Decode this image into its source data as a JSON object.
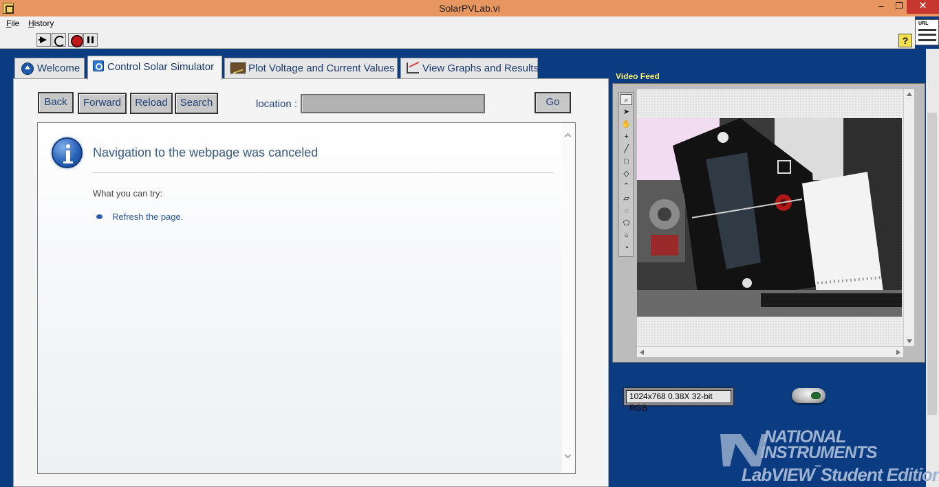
{
  "window": {
    "title": "SolarPVLab.vi",
    "minimize_glyph": "–",
    "maximize_glyph": "❐",
    "close_glyph": "✕"
  },
  "menu": {
    "file_accel": "F",
    "file_rest": "ile",
    "history_accel": "H",
    "history_rest": "istory"
  },
  "toolbar": {
    "help_label": "?",
    "vi_icon_label": "URL"
  },
  "tabs": [
    {
      "label": "Welcome",
      "icon": "home-icon"
    },
    {
      "label": "Control Solar Simulator",
      "icon": "control-icon"
    },
    {
      "label": "Plot Voltage and Current Values",
      "icon": "plot-icon"
    },
    {
      "label": "View Graphs and Results",
      "icon": "graph-icon"
    }
  ],
  "browser": {
    "back_label": "Back",
    "forward_label": "Forward",
    "reload_label": "Reload",
    "search_label": "Search",
    "location_label": "location :",
    "location_value": "",
    "go_label": "Go",
    "page": {
      "heading": "Navigation to the webpage was canceled",
      "try_label": "What you can try:",
      "link_text": "Refresh the page."
    }
  },
  "video_feed": {
    "label": "Video Feed",
    "image_info": "1024x768 0.38X 32-bit RGB",
    "tools": [
      "zoom-tool",
      "pointer-tool",
      "pan-tool",
      "crosshair-tool",
      "line-tool",
      "rectangle-tool",
      "rotated-rectangle-tool",
      "polyline-tool",
      "freehand-tool",
      "freehand-region-tool",
      "polygon-tool",
      "oval-tool",
      "annulus-tool"
    ]
  },
  "branding": {
    "national": "NATIONAL",
    "instruments": "INSTRUMENTS",
    "labview": "LabVIEW",
    "tm": "™",
    "edition": "Student Edition"
  },
  "colors": {
    "titlebar": "#e8965f",
    "background": "#0b3c82",
    "panel": "#f4f4f4",
    "text_blue": "#1e3f75",
    "feed_label": "#f6ef72"
  }
}
